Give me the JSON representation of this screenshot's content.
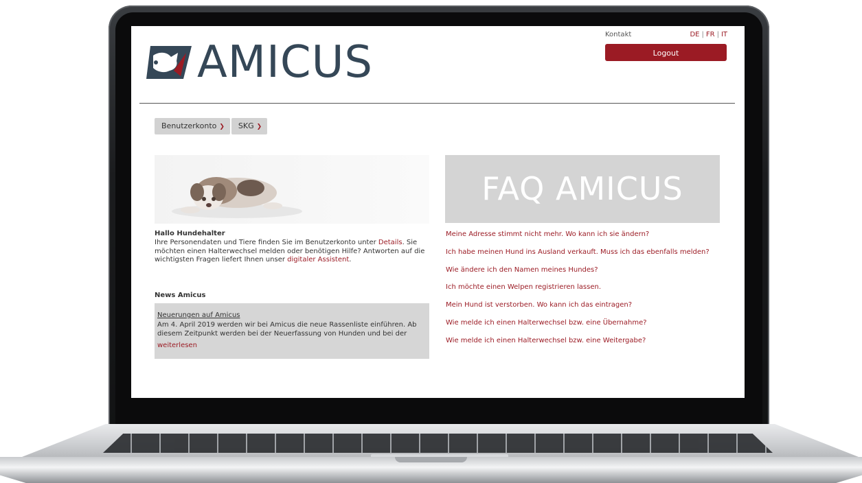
{
  "header": {
    "contact": "Kontakt",
    "languages": [
      "DE",
      "FR",
      "IT"
    ],
    "logout": "Logout",
    "logo_text": "AMICUS"
  },
  "menu": [
    {
      "label": "Benutzerkonto"
    },
    {
      "label": "SKG"
    }
  ],
  "greeting": {
    "title": "Hallo Hundehalter",
    "text_1": "Ihre Personendaten und Tiere finden Sie im Benutzerkonto unter ",
    "link_details": "Details",
    "text_2": ". Sie möchten einen Halterwechsel melden oder benötigen Hilfe? Antworten auf die wichtigsten Fragen liefert Ihnen unser ",
    "link_assistant": "digitaler Assistent",
    "text_3": "."
  },
  "news": {
    "title": "News Amicus",
    "headline": "Neuerungen auf Amicus",
    "text": "Am 4. April 2019 werden wir bei Amicus die neue Rassenliste einführen. Ab diesem Zeitpunkt werden bei der Neuerfassung von Hunden und bei der",
    "more": "weiterlesen"
  },
  "faq": {
    "banner": "FAQ AMICUS",
    "items": [
      "Meine Adresse stimmt nicht mehr. Wo kann ich sie ändern?",
      "Ich habe meinen Hund ins Ausland verkauft. Muss ich das ebenfalls melden?",
      "Wie ändere ich den Namen meines Hundes?",
      "Ich möchte einen Welpen registrieren lassen.",
      "Mein Hund ist verstorben. Wo kann ich das eintragen?",
      "Wie melde ich einen Halterwechsel bzw. eine Übernahme?",
      "Wie melde ich einen Halterwechsel bzw. eine Weitergabe?"
    ]
  },
  "colors": {
    "accent": "#9b1b24",
    "logo": "#354757",
    "panel": "#d4d4d4"
  },
  "icons": {
    "menu_chevron": "chevron-down-icon",
    "logo": "dog-logo-icon"
  }
}
